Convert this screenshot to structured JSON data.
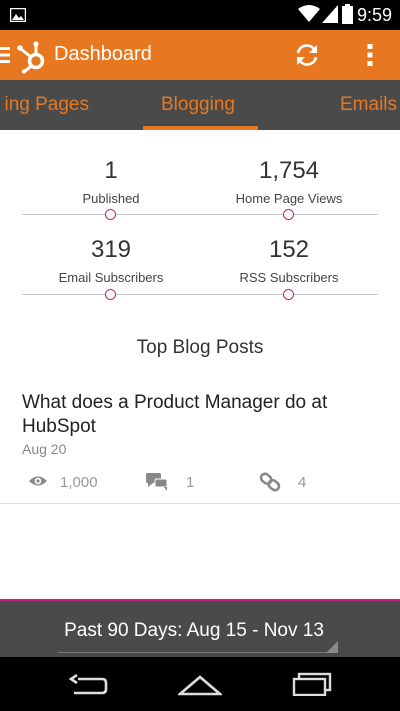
{
  "status_bar": {
    "time": "9:59",
    "icons": [
      "image-icon",
      "wifi-icon",
      "signal-icon",
      "battery-icon"
    ]
  },
  "app_bar": {
    "title": "Dashboard",
    "accent_color": "#e8781f",
    "icons": [
      "menu-icon",
      "hubspot-logo-icon",
      "refresh-icon",
      "overflow-menu-icon"
    ]
  },
  "tabs": [
    {
      "label": "Landing Pages",
      "visible_text": "ing Pages",
      "selected": false
    },
    {
      "label": "Blogging",
      "visible_text": "Blogging",
      "selected": true
    },
    {
      "label": "Emails",
      "visible_text": "Emails",
      "selected": false
    }
  ],
  "stats": [
    {
      "value": "1",
      "label": "Published"
    },
    {
      "value": "1,754",
      "label": "Home Page Views"
    },
    {
      "value": "319",
      "label": "Email Subscribers"
    },
    {
      "value": "152",
      "label": "RSS Subscribers"
    }
  ],
  "top_posts": {
    "title": "Top Blog Posts",
    "posts": [
      {
        "title": "What does a Product Manager do at HubSpot",
        "date": "Aug 20",
        "views": "1,000",
        "comments": "1",
        "links": "4"
      }
    ]
  },
  "date_range": {
    "label": "Past 90 Days: Aug 15 - Nov 13"
  },
  "colors": {
    "accent": "#e8781f",
    "tab_bar": "#4a4a4a",
    "indicator_dot": "#c2207a"
  }
}
